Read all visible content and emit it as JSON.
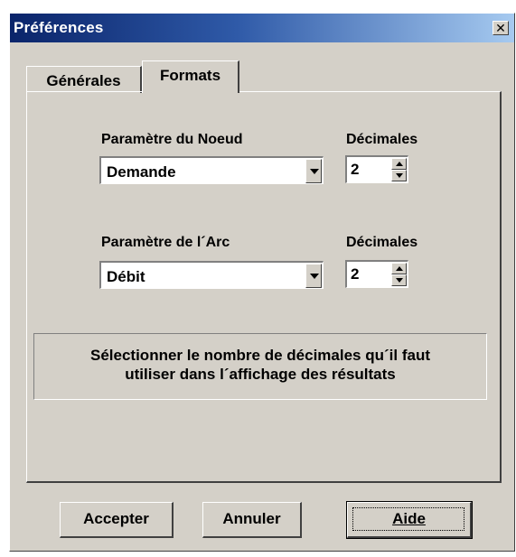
{
  "window": {
    "title": "Préférences",
    "close_label": "✕"
  },
  "tabs": [
    {
      "label": "Générales",
      "active": false
    },
    {
      "label": "Formats",
      "active": true
    }
  ],
  "node": {
    "label": "Paramètre du Noeud",
    "value": "Demande",
    "decimals_label": "Décimales",
    "decimals_value": "2"
  },
  "link": {
    "label": "Paramètre de l´Arc",
    "value": "Débit",
    "decimals_label": "Décimales",
    "decimals_value": "2"
  },
  "info": {
    "line1": "Sélectionner le nombre de décimales qu´il faut",
    "line2": "utiliser dans l´affichage des résultats"
  },
  "buttons": {
    "accept": "Accepter",
    "cancel": "Annuler",
    "help": "Aide"
  },
  "icons": {
    "close": "close-icon",
    "dropdown": "chevron-down-icon",
    "spin_up": "arrow-up-icon",
    "spin_down": "arrow-down-icon"
  },
  "colors": {
    "title_start": "#0a246a",
    "title_end": "#a6caf0",
    "face": "#d4d0c8"
  }
}
